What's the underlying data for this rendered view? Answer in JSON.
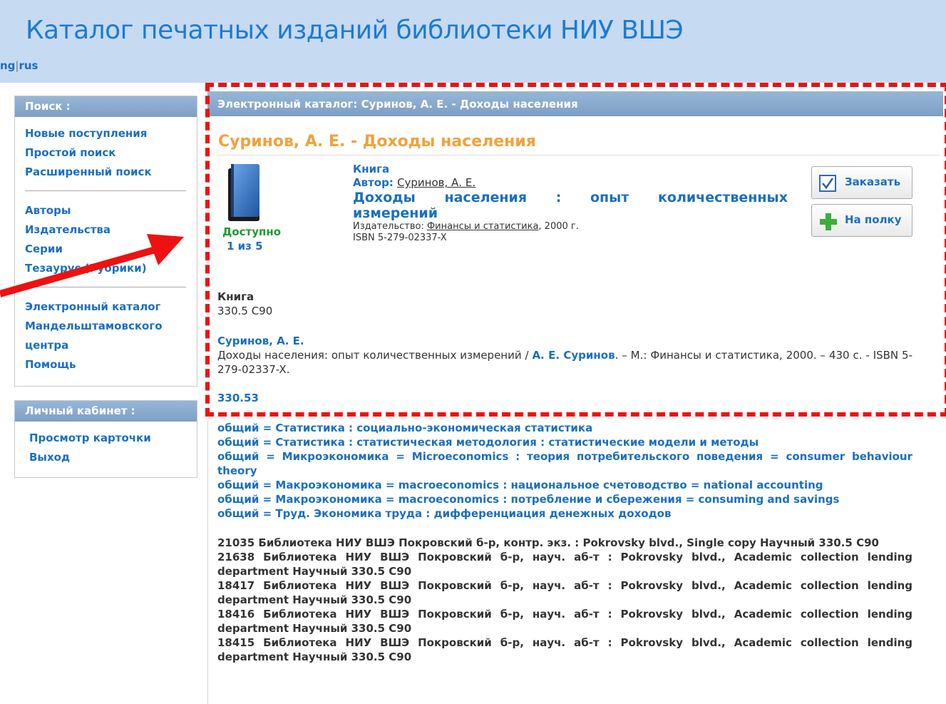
{
  "header": {
    "title": "Каталог печатных изданий библиотеки НИУ ВШЭ",
    "lang_eng": "ng",
    "lang_sep": "|",
    "lang_rus": "rus"
  },
  "sidebar": {
    "search_head": "Поиск :",
    "search_links": [
      "Новые поступления",
      "Простой поиск",
      "Расширенный поиск"
    ],
    "browse_links": [
      "Авторы",
      "Издательства",
      "Серии",
      "Тезаурус (Рубрики)"
    ],
    "other_links": [
      "Электронный каталог",
      "Мандельштамовского",
      "центра",
      "Помощь"
    ],
    "cabinet_head": "Личный кабинет :",
    "cabinet_links": [
      "Просмотр карточки",
      "Выход"
    ]
  },
  "main": {
    "head": "Электронный каталог: Суринов, А. Е. - Доходы населения",
    "record_title": "Суринов, А. Е. - Доходы населения",
    "availability": "Доступно",
    "availability_count": "1 из 5",
    "type": "Книга",
    "author_label": "Автор: ",
    "author": "Суринов, А. Е.",
    "book_title": "Доходы населения : опыт количественных измерений",
    "publisher_label": "Издательство: ",
    "publisher": "Финансы и статистика",
    "year": ", 2000 г.",
    "isbn": "ISBN 5-279-02337-X",
    "order_button": "Заказать",
    "shelf_button": "На полку",
    "desc_type": "Книга",
    "shelfmark": "330.5 С90",
    "desc_author": "Суринов, А. Е.",
    "desc_text_1": "Доходы населения: опыт количественных измерений / ",
    "desc_author_link": "А. Е. Суринов",
    "desc_text_2": ". – М.: Финансы и статистика, 2000. – 430 с. - ISBN 5-279-02337-X.",
    "udc": "330.53",
    "subjects": [
      "общий = Статистика : социально-экономическая статистика",
      "общий = Статистика : статистическая методология : статистические модели и методы",
      "общий = Микроэкономика = Microeconomics : теория потребительского поведения = consumer behaviour theory",
      "общий = Макроэкономика = macroeconomics : национальное счетоводство = national accounting",
      "общий = Макроэкономика = macroeconomics : потребление и сбережения = consuming and savings",
      "общий = Труд. Экономика труда : дифференциация денежных доходов"
    ],
    "copies": [
      "21035 Библиотека НИУ ВШЭ Покровский б-р, контр. экз. : Pokrovsky blvd., Single copy Научный 330.5 С90",
      "21638 Библиотека НИУ ВШЭ Покровский б-р, науч. аб-т : Pokrovsky blvd., Academic collection lending department Научный 330.5 С90",
      "18417 Библиотека НИУ ВШЭ Покровский б-р, науч. аб-т : Pokrovsky blvd., Academic collection lending department Научный 330.5 С90",
      "18416 Библиотека НИУ ВШЭ Покровский б-р, науч. аб-т : Pokrovsky blvd., Academic collection lending department Научный 330.5 С90",
      "18415 Библиотека НИУ ВШЭ Покровский б-р, науч. аб-т : Pokrovsky blvd., Academic collection lending department Научный 330.5 С90"
    ]
  },
  "colors": {
    "header_bg": "#c6daf1",
    "title": "#1d7bcf",
    "link": "#1a6fbf",
    "accent_orange": "#f0a23c",
    "available_green": "#1e9a2e",
    "annotation_red": "#ee1111"
  },
  "icons": {
    "book": "book-icon",
    "order": "checkbox-icon",
    "shelf": "plus-icon",
    "annotation_arrow": "arrow-icon"
  }
}
